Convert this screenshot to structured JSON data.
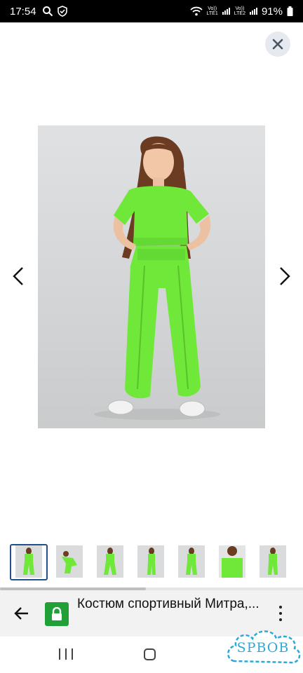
{
  "status_bar": {
    "time": "17:54",
    "sim1_label": "Vo))",
    "sim1_sub": "LTE1",
    "sim2_label": "Vo))",
    "sim2_sub": "LTE2",
    "battery": "91%",
    "icons": [
      "search-icon",
      "shield-check-icon",
      "wifi-icon",
      "signal-icon",
      "battery-icon"
    ]
  },
  "viewer": {
    "close_icon": "close-icon",
    "prev_icon": "chevron-left-icon",
    "next_icon": "chevron-right-icon",
    "thumbnails_count": 7,
    "selected_index": 0
  },
  "browser_bar": {
    "page_title": "Костюм спортивный Митра,...",
    "lock_color": "#21a038"
  },
  "watermark": {
    "text": "SPBOB",
    "color": "#2fa8d8"
  },
  "colors": {
    "accent_green": "#6fe83a",
    "selected_border": "#244f8a"
  }
}
